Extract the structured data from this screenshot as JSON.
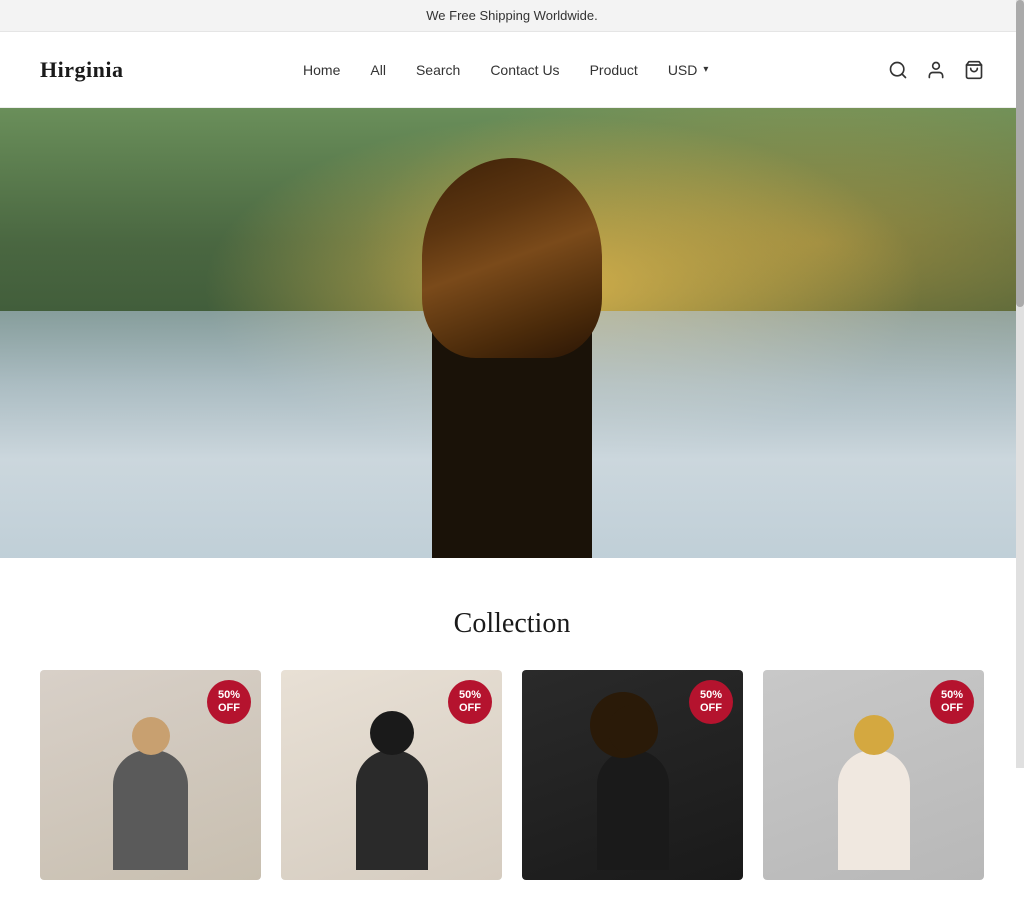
{
  "announcement": {
    "text": "We Free Shipping Worldwide."
  },
  "header": {
    "logo": "Hirginia",
    "nav": {
      "items": [
        {
          "label": "Home",
          "id": "home"
        },
        {
          "label": "All",
          "id": "all"
        },
        {
          "label": "Search",
          "id": "search"
        },
        {
          "label": "Contact Us",
          "id": "contact-us"
        },
        {
          "label": "Product",
          "id": "product"
        }
      ]
    },
    "currency": {
      "label": "USD",
      "arrow": "▾"
    }
  },
  "collection": {
    "title": "Collection",
    "products": [
      {
        "discount": "50%\nOFF",
        "alt": "Woman in grey top"
      },
      {
        "discount": "50%\nOFF",
        "alt": "Woman with dark hair"
      },
      {
        "discount": "50%\nOFF",
        "alt": "Woman with curly hair"
      },
      {
        "discount": "50%\nOFF",
        "alt": "Blonde woman"
      }
    ]
  },
  "icons": {
    "search": "🔍",
    "account": "👤",
    "cart": "🛒"
  }
}
